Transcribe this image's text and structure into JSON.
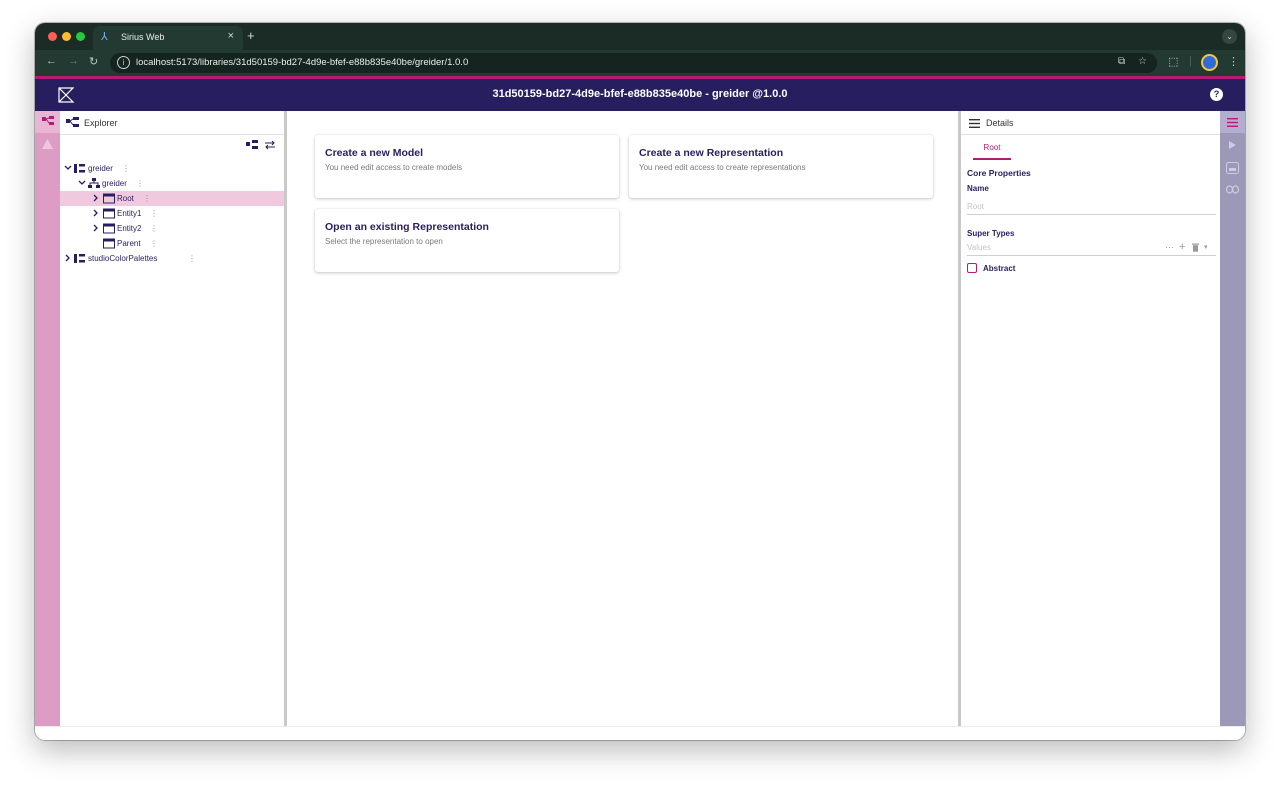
{
  "browser": {
    "tab_title": "Sirius Web",
    "url": "localhost:5173/libraries/31d50159-bd27-4d9e-bfef-e88b835e40be/greider/1.0.0"
  },
  "app": {
    "title": "31d50159-bd27-4d9e-bfef-e88b835e40be - greider @1.0.0"
  },
  "explorer": {
    "title": "Explorer",
    "tree": [
      {
        "label": "greider",
        "depth": 0,
        "expanded": true,
        "icon": "library-icon"
      },
      {
        "label": "greider",
        "depth": 1,
        "expanded": true,
        "icon": "model-icon"
      },
      {
        "label": "Root",
        "depth": 2,
        "expanded": false,
        "icon": "entity-icon",
        "selected": true
      },
      {
        "label": "Entity1",
        "depth": 2,
        "expanded": false,
        "icon": "entity-icon"
      },
      {
        "label": "Entity2",
        "depth": 2,
        "expanded": false,
        "icon": "entity-icon"
      },
      {
        "label": "Parent",
        "depth": 2,
        "icon": "entity-icon"
      },
      {
        "label": "studioColorPalettes",
        "depth": 0,
        "expanded": false,
        "icon": "library-icon"
      }
    ]
  },
  "main": {
    "cards": [
      {
        "title": "Create a new Model",
        "subtitle": "You need edit access to create models"
      },
      {
        "title": "Create a new Representation",
        "subtitle": "You need edit access to create representations"
      },
      {
        "title": "Open an existing Representation",
        "subtitle": "Select the representation to open"
      }
    ]
  },
  "details": {
    "title": "Details",
    "tab": "Root",
    "section": "Core Properties",
    "name_label": "Name",
    "name_value": "Root",
    "super_types_label": "Super Types",
    "super_types_placeholder": "Values",
    "abstract_label": "Abstract"
  },
  "colors": {
    "header": "#261e5f",
    "accent": "#b51b76",
    "left_rail": "#dd9cc4",
    "right_rail": "#9c98b8"
  }
}
